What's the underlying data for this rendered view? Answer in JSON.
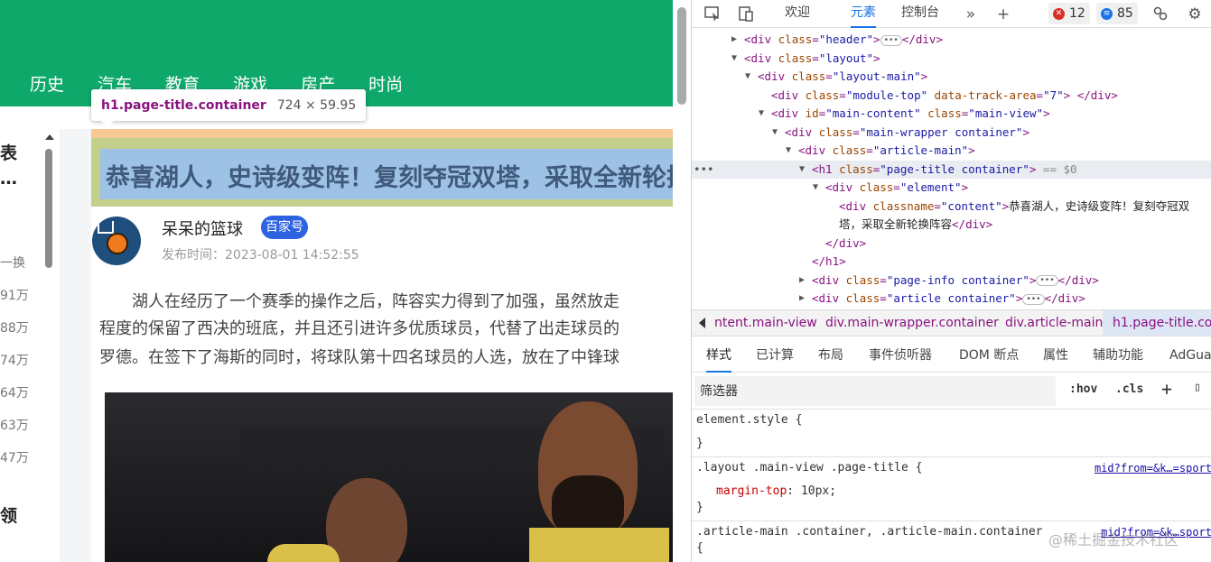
{
  "page": {
    "nav_items": [
      "历史",
      "汽车",
      "教育",
      "游戏",
      "房产",
      "时尚"
    ],
    "sidebar": {
      "heading1": "表",
      "heading1_sub": "…",
      "row_prefix": "一换",
      "rows": [
        "91万",
        "88万",
        "74万",
        "64万",
        "63万",
        "47万"
      ],
      "heading2": "领"
    },
    "tooltip": {
      "selector": "h1.page-title.container",
      "size": "724 × 59.95"
    },
    "article_title": "恭喜湖人，史诗级变阵！复刻夺冠双塔，采取全新轮换阵容",
    "author": {
      "name": "呆呆的篮球",
      "badge": "百家号",
      "publish_time": "发布时间：2023-08-01 14:52:55"
    },
    "body_lines": [
      "　　湖人在经历了一个赛季的操作之后，阵容实力得到了加强，虽然放走",
      "程度的保留了西决的班底，并且还引进许多优质球员，代替了出走球员的",
      "罗德。在签下了海斯的同时，将球队第十四名球员的人选，放在了中锋球"
    ]
  },
  "devtools": {
    "toolbar": {
      "tabs": [
        "欢迎",
        "元素",
        "控制台"
      ],
      "active_tab": "元素",
      "error_count": "12",
      "message_count": "85"
    },
    "dom_lines": [
      {
        "indent": 0,
        "arrow": "▶",
        "tag": "div",
        "attr": "class",
        "val": "header",
        "collapsed": true
      },
      {
        "indent": 0,
        "arrow": "▼",
        "tag": "div",
        "attr": "class",
        "val": "layout"
      },
      {
        "indent": 1,
        "arrow": "▼",
        "tag": "div",
        "attr": "class",
        "val": "layout-main"
      },
      {
        "indent": 2,
        "arrow": "",
        "tag": "div",
        "attr": "class",
        "val": "module-top",
        "extra_attr": "data-track-area",
        "extra_val": "7",
        "closed": true
      },
      {
        "indent": 2,
        "arrow": "▼",
        "tag": "div",
        "attr": "id",
        "val": "main-content",
        "extra_attr": "class",
        "extra_val": "main-view"
      },
      {
        "indent": 3,
        "arrow": "▼",
        "tag": "div",
        "attr": "class",
        "val": "main-wrapper container"
      },
      {
        "indent": 4,
        "arrow": "▼",
        "tag": "div",
        "attr": "class",
        "val": "article-main"
      },
      {
        "indent": 5,
        "arrow": "▼",
        "tag": "h1",
        "attr": "class",
        "val": "page-title container",
        "selected": true,
        "suffix": "== $0"
      },
      {
        "indent": 6,
        "arrow": "▼",
        "tag": "div",
        "attr": "class",
        "val": "element"
      },
      {
        "indent": 7,
        "arrow": "",
        "tag": "div",
        "attr": "classname",
        "val": "content",
        "text": "恭喜湖人，史诗级变阵！复刻夺冠双"
      },
      {
        "indent": 7,
        "arrow": "",
        "text_only": "塔，采取全新轮换阵容",
        "close_tag": "div"
      },
      {
        "indent": 6,
        "arrow": "",
        "close_only": "div"
      },
      {
        "indent": 5,
        "arrow": "",
        "close_only": "h1"
      },
      {
        "indent": 5,
        "arrow": "▶",
        "tag": "div",
        "attr": "class",
        "val": "page-info container",
        "collapsed": true
      },
      {
        "indent": 5,
        "arrow": "▶",
        "tag": "div",
        "attr": "class",
        "val": "article container",
        "collapsed": true
      }
    ],
    "breadcrumbs": [
      "ntent.main-view",
      "div.main-wrapper.container",
      "div.article-main",
      "h1.page-title.con"
    ],
    "subtabs": [
      "样式",
      "已计算",
      "布局",
      "事件侦听器",
      "DOM 断点",
      "属性",
      "辅助功能",
      "AdGua"
    ],
    "active_subtab": "样式",
    "filter": {
      "placeholder": "筛选器",
      "hov": ":hov",
      "cls": ".cls"
    },
    "styles": {
      "rule1_selector": "element.style {",
      "rule1_close": "}",
      "rule2_selector": ".layout .main-view .page-title {",
      "rule2_link": "mid?from=&k…=sport",
      "rule2_prop": "margin-top",
      "rule2_val": "10px;",
      "rule2_close": "}",
      "rule3_selector": ".article-main .container, .article-main.container",
      "rule3_link": "mid?from=&k…sport",
      "rule3_open": "{"
    },
    "watermark": "@稀土掘金技术社区"
  }
}
